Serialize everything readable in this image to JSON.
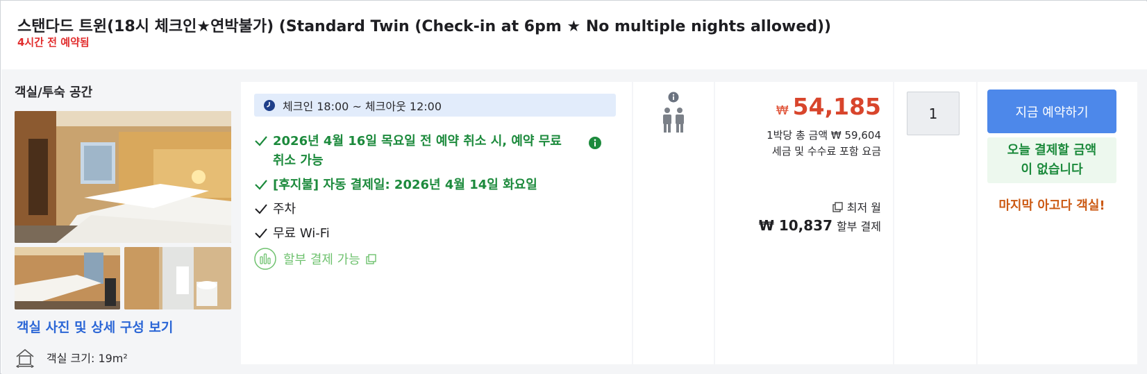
{
  "header": {
    "room_title": "스탠다드 트윈(18시 체크인★연박불가) (Standard Twin (Check-in at 6pm ★ No multiple nights allowed))",
    "booked_note": "4시간 전 예약됨"
  },
  "left": {
    "space_label": "객실/투숙 공간",
    "gallery_link": "객실 사진 및 상세 구성 보기",
    "room_size": "객실 크기: 19m²"
  },
  "features": {
    "checkin_text": "체크인 18:00 ~ 체크아웃 12:00",
    "free_cancel_line1": "2026년 4월 16일 목요일 전 예약 취소 시, 예약 무료",
    "free_cancel_line2": "취소 가능",
    "auto_payment": "[후지불] 자동 결제일: 2026년 4월 14일 화요일",
    "parking": "주차",
    "wifi": "무료 Wi-Fi",
    "installment": "할부 결제 가능"
  },
  "price": {
    "currency": "₩",
    "amount": "54,185",
    "per_night_total": "1박당 총 금액 ₩ 59,604",
    "tax_note": "세금 및 수수료 포함 요금",
    "monthly_label": "최저 월",
    "monthly_amount": "₩ 10,837",
    "monthly_suffix": "할부 결제"
  },
  "quantity": {
    "value": "1"
  },
  "action": {
    "book_button": "지금 예약하기",
    "pay_today_line1": "오늘 결제할 금액",
    "pay_today_line2": "이 없습니다",
    "last_room": "마지막 아고다 객실!"
  },
  "colors": {
    "accent_blue": "#4d88ea",
    "price_red": "#d8452c",
    "green": "#1c8a3c",
    "urgent_orange": "#cc5a14"
  },
  "icons": [
    "clock-icon",
    "check-icon",
    "info-icon",
    "installment-icon",
    "external-link-icon",
    "occupancy-icon",
    "room-size-icon"
  ]
}
